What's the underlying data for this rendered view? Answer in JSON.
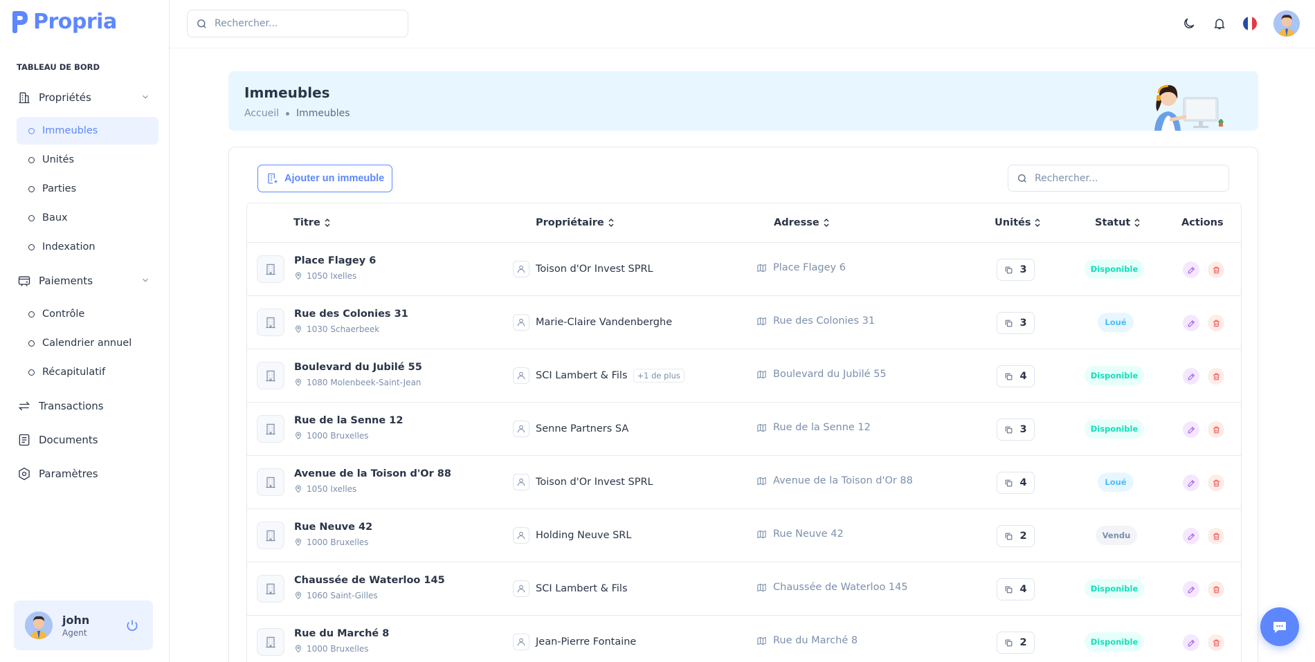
{
  "app": {
    "brand": "Propria",
    "brand_color": "#5d87ff"
  },
  "sidebar": {
    "section_label": "TABLEAU DE BORD",
    "groups": [
      {
        "label": "Propriétés",
        "icon": "building-icon",
        "items": [
          "Immeubles",
          "Unités",
          "Parties",
          "Baux",
          "Indexation"
        ],
        "active": "Immeubles"
      },
      {
        "label": "Paiements",
        "icon": "wallet-icon",
        "items": [
          "Contrôle",
          "Calendrier annuel",
          "Récapitulatif"
        ]
      }
    ],
    "links": [
      {
        "label": "Transactions",
        "icon": "transfer-icon"
      },
      {
        "label": "Documents",
        "icon": "document-icon"
      },
      {
        "label": "Paramètres",
        "icon": "settings-icon"
      }
    ],
    "user": {
      "name": "john",
      "role": "Agent"
    }
  },
  "topbar": {
    "search_placeholder": "Rechercher..."
  },
  "breadcrumb": {
    "title": "Immeubles",
    "home": "Accueil",
    "current": "Immeubles"
  },
  "toolbar": {
    "add_label": "Ajouter un immeuble",
    "search_placeholder": "Rechercher..."
  },
  "table": {
    "headers": {
      "title": "Titre",
      "owner": "Propriétaire",
      "address": "Adresse",
      "units": "Unités",
      "status": "Statut",
      "actions": "Actions"
    },
    "rows": [
      {
        "title": "Place Flagey 6",
        "city": "1050 Ixelles",
        "owner": "Toison d'Or Invest SPRL",
        "more": "",
        "address": "Place Flagey 6",
        "units": "3",
        "status": "Disponible",
        "status_kind": "dispo"
      },
      {
        "title": "Rue des Colonies 31",
        "city": "1030 Schaerbeek",
        "owner": "Marie-Claire Vandenberghe",
        "more": "",
        "address": "Rue des Colonies 31",
        "units": "3",
        "status": "Loué",
        "status_kind": "loue"
      },
      {
        "title": "Boulevard du Jubilé 55",
        "city": "1080 Molenbeek-Saint-Jean",
        "owner": "SCI Lambert & Fils",
        "more": "+1 de plus",
        "address": "Boulevard du Jubilé 55",
        "units": "4",
        "status": "Disponible",
        "status_kind": "dispo"
      },
      {
        "title": "Rue de la Senne 12",
        "city": "1000 Bruxelles",
        "owner": "Senne Partners SA",
        "more": "",
        "address": "Rue de la Senne 12",
        "units": "3",
        "status": "Disponible",
        "status_kind": "dispo"
      },
      {
        "title": "Avenue de la Toison d'Or 88",
        "city": "1050 Ixelles",
        "owner": "Toison d'Or Invest SPRL",
        "more": "",
        "address": "Avenue de la Toison d'Or 88",
        "units": "4",
        "status": "Loué",
        "status_kind": "loue"
      },
      {
        "title": "Rue Neuve 42",
        "city": "1000 Bruxelles",
        "owner": "Holding Neuve SRL",
        "more": "",
        "address": "Rue Neuve 42",
        "units": "2",
        "status": "Vendu",
        "status_kind": "vendu"
      },
      {
        "title": "Chaussée de Waterloo 145",
        "city": "1060 Saint-Gilles",
        "owner": "SCI Lambert & Fils",
        "more": "",
        "address": "Chaussée de Waterloo 145",
        "units": "4",
        "status": "Disponible",
        "status_kind": "dispo"
      },
      {
        "title": "Rue du Marché 8",
        "city": "1000 Bruxelles",
        "owner": "Jean-Pierre Fontaine",
        "more": "",
        "address": "Rue du Marché 8",
        "units": "2",
        "status": "Disponible",
        "status_kind": "dispo"
      }
    ]
  },
  "colors": {
    "available": "#13deb9",
    "rented": "#49beff",
    "sold": "#7c8fac",
    "edit": "#a855f7",
    "delete": "#fa5a5a"
  }
}
